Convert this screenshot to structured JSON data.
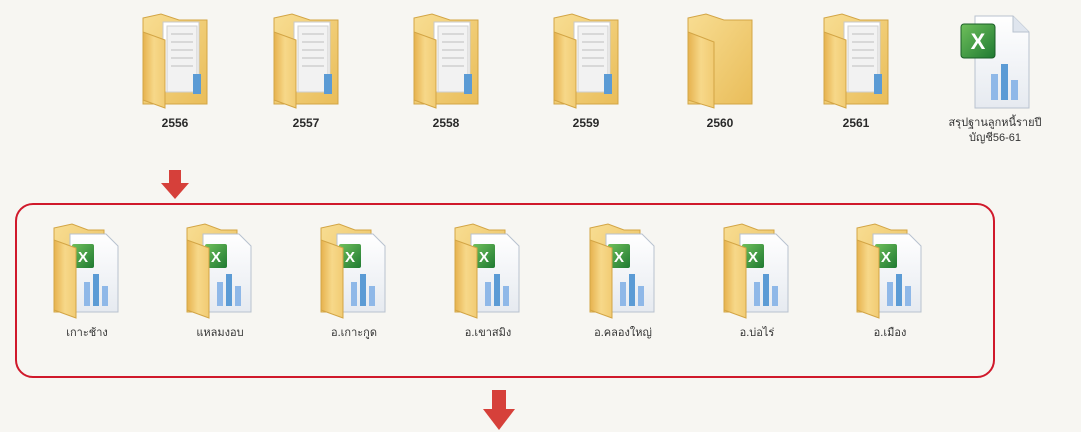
{
  "top_row": [
    {
      "label": "2556",
      "icon": "folder-with-files-icon"
    },
    {
      "label": "2557",
      "icon": "folder-with-files-icon"
    },
    {
      "label": "2558",
      "icon": "folder-with-files-icon"
    },
    {
      "label": "2559",
      "icon": "folder-with-files-icon"
    },
    {
      "label": "2560",
      "icon": "folder-icon"
    },
    {
      "label": "2561",
      "icon": "folder-with-files-icon"
    },
    {
      "label": "สรุปฐานลูกหนี้รายปี\nบัญชี56-61",
      "icon": "excel-file-icon"
    }
  ],
  "group": {
    "items": [
      {
        "label": "เกาะช้าง",
        "icon": "folder-with-excel-icon"
      },
      {
        "label": "แหลมงอบ",
        "icon": "folder-with-excel-icon"
      },
      {
        "label": "อ.เกาะกูด",
        "icon": "folder-with-excel-icon"
      },
      {
        "label": "อ.เขาสมิง",
        "icon": "folder-with-excel-icon"
      },
      {
        "label": "อ.คลองใหญ่",
        "icon": "folder-with-excel-icon"
      },
      {
        "label": "อ.บ่อไร่",
        "icon": "folder-with-excel-icon"
      },
      {
        "label": "อ.เมือง",
        "icon": "folder-with-excel-icon"
      }
    ],
    "border_color": "#d0192b"
  },
  "arrow_color": "#d6403a",
  "folder_color": "#f5d27a"
}
